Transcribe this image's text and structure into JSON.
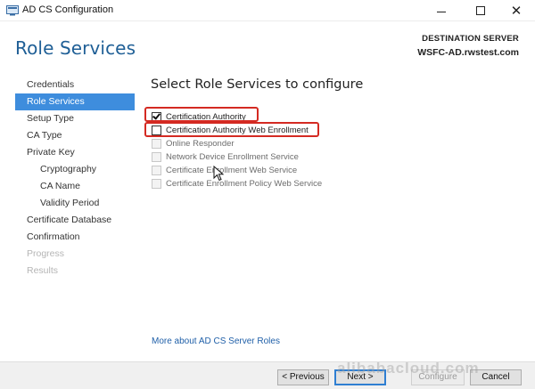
{
  "window": {
    "title": "AD CS Configuration",
    "minimize_icon": "minimize-icon",
    "maximize_icon": "maximize-icon",
    "close_icon": "close-icon"
  },
  "header": {
    "page_title": "Role Services",
    "destination_label": "DESTINATION SERVER",
    "destination_value": "WSFC-AD.rwstest.com"
  },
  "sidebar": {
    "items": [
      {
        "label": "Credentials",
        "state": "normal"
      },
      {
        "label": "Role Services",
        "state": "active"
      },
      {
        "label": "Setup Type",
        "state": "normal"
      },
      {
        "label": "CA Type",
        "state": "normal"
      },
      {
        "label": "Private Key",
        "state": "normal"
      },
      {
        "label": "Cryptography",
        "state": "sub"
      },
      {
        "label": "CA Name",
        "state": "sub"
      },
      {
        "label": "Validity Period",
        "state": "sub"
      },
      {
        "label": "Certificate Database",
        "state": "normal"
      },
      {
        "label": "Confirmation",
        "state": "normal"
      },
      {
        "label": "Progress",
        "state": "disabled"
      },
      {
        "label": "Results",
        "state": "disabled"
      }
    ]
  },
  "main": {
    "heading": "Select Role Services to configure",
    "roles": [
      {
        "label": "Certification Authority",
        "checked": true,
        "enabled": true
      },
      {
        "label": "Certification Authority Web Enrollment",
        "checked": false,
        "enabled": true
      },
      {
        "label": "Online Responder",
        "checked": false,
        "enabled": false
      },
      {
        "label": "Network Device Enrollment Service",
        "checked": false,
        "enabled": false
      },
      {
        "label": "Certificate Enrollment Web Service",
        "checked": false,
        "enabled": false
      },
      {
        "label": "Certificate Enrollment Policy Web Service",
        "checked": false,
        "enabled": false
      }
    ],
    "more_link": "More about AD CS Server Roles"
  },
  "footer": {
    "previous_label": "< Previous",
    "next_label": "Next >",
    "configure_label": "Configure",
    "cancel_label": "Cancel"
  },
  "watermark": "alibabacloud.com",
  "colors": {
    "accent": "#3e8ddd",
    "title": "#1f5f96",
    "highlight": "#d42a22",
    "link": "#1f5fa8"
  }
}
